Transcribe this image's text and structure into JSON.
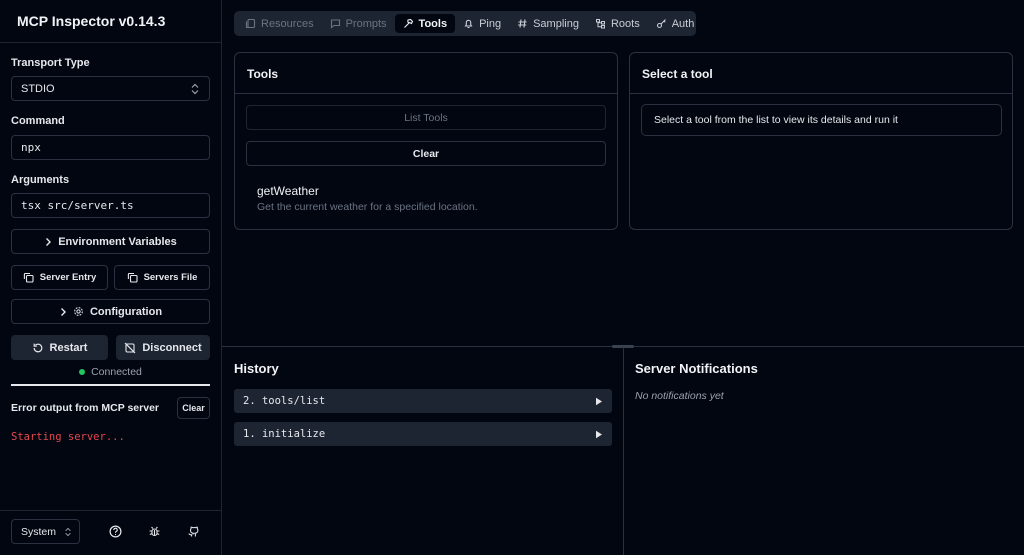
{
  "app": {
    "title": "MCP Inspector v0.14.3"
  },
  "sidebar": {
    "transport_label": "Transport Type",
    "transport_value": "STDIO",
    "command_label": "Command",
    "command_value": "npx",
    "arguments_label": "Arguments",
    "arguments_value": "tsx src/server.ts",
    "env_button": "Environment Variables",
    "server_entry_button": "Server Entry",
    "servers_file_button": "Servers File",
    "config_button": "Configuration",
    "restart_button": "Restart",
    "disconnect_button": "Disconnect",
    "status": "Connected",
    "error_title": "Error output from MCP server",
    "error_clear": "Clear",
    "error_output": "Starting server...",
    "theme_value": "System"
  },
  "tabs": [
    {
      "label": "Resources",
      "icon": "files-icon",
      "state": "disabled"
    },
    {
      "label": "Prompts",
      "icon": "message-icon",
      "state": "disabled"
    },
    {
      "label": "Tools",
      "icon": "hammer-icon",
      "state": "active"
    },
    {
      "label": "Ping",
      "icon": "bell-icon",
      "state": "enabled"
    },
    {
      "label": "Sampling",
      "icon": "hash-icon",
      "state": "enabled"
    },
    {
      "label": "Roots",
      "icon": "folder-tree-icon",
      "state": "enabled"
    },
    {
      "label": "Auth",
      "icon": "key-icon",
      "state": "enabled"
    }
  ],
  "tools_panel": {
    "title": "Tools",
    "list_button": "List Tools",
    "clear_button": "Clear",
    "tools": [
      {
        "name": "getWeather",
        "description": "Get the current weather for a specified location."
      }
    ]
  },
  "detail_panel": {
    "title": "Select a tool",
    "hint": "Select a tool from the list to view its details and run it"
  },
  "history": {
    "title": "History",
    "items": [
      {
        "label": "2. tools/list"
      },
      {
        "label": "1. initialize"
      }
    ]
  },
  "notifications": {
    "title": "Server Notifications",
    "empty": "No notifications yet"
  },
  "colors": {
    "background": "#020611",
    "surface": "#1e2532",
    "border": "#2a3140",
    "connected": "#22c55e",
    "error_text": "#e5484d"
  }
}
